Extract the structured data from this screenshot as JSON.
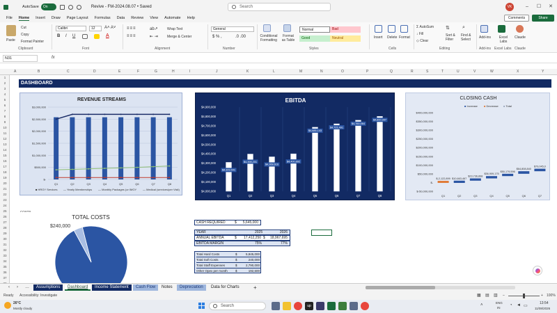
{
  "app": {
    "autosave_label": "AutoSave",
    "autosave_state": "On",
    "doc_title": "Revive - FM-2024.08.07 • Saved",
    "search_placeholder": "Search",
    "user_initials": "VK",
    "comments_label": "Comments",
    "share_label": "Share"
  },
  "menu": [
    "File",
    "Home",
    "Insert",
    "Draw",
    "Page Layout",
    "Formulas",
    "Data",
    "Review",
    "View",
    "Automate",
    "Help"
  ],
  "ribbon": {
    "paste": "Paste",
    "cut": "Cut",
    "copy": "Copy",
    "format_painter": "Format Painter",
    "font_name": "Calibri",
    "font_size": "12",
    "wrap_text": "Wrap Text",
    "merge_center": "Merge & Center",
    "number_format": "General",
    "conditional": "Conditional Formatting",
    "format_table": "Format as Table",
    "style_normal": "Normal",
    "style_bad": "Bad",
    "style_good": "Good",
    "style_neutral": "Neutral",
    "insert": "Insert",
    "delete": "Delete",
    "format": "Format",
    "autosum": "AutoSum",
    "fill": "Fill",
    "clear": "Clear",
    "sort_filter": "Sort & Filter",
    "find_select": "Find & Select",
    "addins": "Add-ins",
    "excel_labs": "Excel Labs",
    "claude": "Claude",
    "groups": [
      "Clipboard",
      "Font",
      "Alignment",
      "Number",
      "Styles",
      "Cells",
      "Editing",
      "Add-ins",
      "Excel Labs",
      "Claude"
    ]
  },
  "formula_bar": {
    "name_box": "N31",
    "fx": "fx",
    "value": ""
  },
  "columns": [
    "A",
    "B",
    "C",
    "D",
    "E",
    "F",
    "G",
    "H",
    "I",
    "J",
    "K",
    "L",
    "M",
    "N",
    "O",
    "P",
    "Q",
    "R",
    "S",
    "T",
    "U",
    "V",
    "W",
    "X",
    "Y"
  ],
  "rows": [
    "1",
    "2",
    "3",
    "4",
    "5",
    "6",
    "7",
    "8",
    "9",
    "10",
    "11",
    "12",
    "13",
    "14",
    "15",
    "16",
    "17",
    "18",
    "19",
    "20",
    "21",
    "22",
    "23",
    "24",
    "25",
    "26",
    "27",
    "28",
    "29",
    "30",
    "31",
    "32",
    "33",
    "34",
    "35",
    "36",
    "37",
    "38",
    "39"
  ],
  "dashboard_title": "DASHBOARD",
  "charts": {
    "revenue": {
      "title": "REVENUE STREAMS",
      "yticks": [
        "$3,000,000",
        "$2,500,000",
        "$2,000,000",
        "$1,500,000",
        "$1,000,000",
        "$500,000",
        "$-"
      ],
      "legend": [
        "HRGY Services",
        "Yearly Memberships",
        "Monthly Packages (or IMGY",
        "Medical (services/per Visit)"
      ]
    },
    "ebitda": {
      "title": "EBITDA",
      "yticks": [
        "$4,900,000",
        "$4,800,000",
        "$4,700,000",
        "$4,600,000",
        "$4,500,000",
        "$4,400,000",
        "$4,300,000",
        "$4,200,000",
        "$4,100,000",
        "$4,000,000"
      ]
    },
    "closing_cash": {
      "title": "CLOSING CASH",
      "legend": [
        "Increase",
        "Decrease",
        "Total"
      ],
      "yticks": [
        "$400,000,000",
        "$350,000,000",
        "$300,000,000",
        "$250,000,000",
        "$200,000,000",
        "$150,000,000",
        "$100,000,000",
        "$50,000,000",
        "$-",
        "$-50,000,000"
      ]
    },
    "total_costs": {
      "section_label": "COSTS",
      "title": "TOTAL COSTS",
      "slice_label": "$240,000"
    }
  },
  "chart_data": [
    {
      "type": "bar",
      "title": "REVENUE STREAMS",
      "categories": [
        "Q1",
        "Q2",
        "Q3",
        "Q4",
        "Q5",
        "Q6",
        "Q7",
        "Q8"
      ],
      "ylim": [
        0,
        3000000
      ],
      "series": [
        {
          "name": "HRGY Services",
          "values": [
            2580000,
            2580000,
            2580000,
            2580000,
            2580000,
            2580000,
            2580000,
            2580000
          ]
        },
        {
          "name": "Yearly Memberships",
          "values": [
            2500000,
            2700000,
            2700000,
            2700000,
            2700000,
            2700000,
            2700000,
            2700000
          ]
        },
        {
          "name": "Monthly Packages (or IMGY",
          "values": [
            400000,
            420000,
            440000,
            460000,
            480000,
            500000,
            530000,
            560000
          ]
        },
        {
          "name": "Medical (services/per Visit)",
          "values": [
            80000,
            80000,
            80000,
            80000,
            80000,
            80000,
            80000,
            80000
          ]
        }
      ]
    },
    {
      "type": "bar",
      "title": "EBITDA",
      "categories": [
        "Q1",
        "Q2",
        "Q3",
        "Q4",
        "Q5",
        "Q6",
        "Q7",
        "Q8"
      ],
      "ylim": [
        4000000,
        4900000
      ],
      "values": [
        4309541,
        4398201,
        4368616,
        4400892,
        4685143,
        4721491,
        4760064,
        4800997
      ],
      "labels": [
        "$4,309,541",
        "$4,398,201",
        "$4,368,616",
        "$4,400,892",
        "$4,685,143",
        "$4,721,491",
        "$4,760,064",
        "$4,800,997"
      ]
    },
    {
      "type": "bar",
      "title": "CLOSING CASH",
      "categories": [
        "Q1",
        "Q2",
        "Q3",
        "Q4",
        "Q5",
        "Q6",
        "Q7"
      ],
      "ylim": [
        -50000000,
        400000000
      ],
      "values": [
        -2122899,
        10663467,
        23736898,
        36909175,
        50179596,
        64808840,
        79045000
      ],
      "labels": [
        "$-2,122,899",
        "$10,663,467",
        "$23,736,898",
        "$36,909,175",
        "$50,179,596",
        "$64,808,840",
        "$79,045,0"
      ]
    },
    {
      "type": "pie",
      "title": "TOTAL COSTS",
      "categories": [
        "Total Hard Costs",
        "Total Soft Costs"
      ],
      "values": [
        5845000,
        240000
      ]
    }
  ],
  "table1": {
    "cash_required_label": "CASH REQUIRED",
    "cash_required_cur": "$",
    "cash_required_value": "5,645,000",
    "year_label": "YEAR",
    "year_1": "2025",
    "year_2": "2026",
    "annual_ebitda_label": "ANNUAL EBITDA",
    "annual_ebitda_cur": "$",
    "annual_ebitda_1": "17,412,250",
    "annual_ebitda_cur2": "$",
    "annual_ebitda_2": "18,967,695",
    "ebitda_margin_label": "EBITDA MARGIN",
    "ebitda_margin_1": "75%",
    "ebitda_margin_2": "77%"
  },
  "table2": {
    "rows": [
      {
        "label": "Total Hard Costs",
        "cur": "$",
        "value": "5,845,000"
      },
      {
        "label": "Total Soft Costs",
        "cur": "$",
        "value": "240,000"
      },
      {
        "label": "Total Staff Expenses",
        "cur": "$",
        "value": "2,790,000"
      },
      {
        "label": "Other Opex per month",
        "cur": "$",
        "value": "192,600"
      }
    ]
  },
  "sheet_tabs": [
    "Assumptions",
    "Dashboard",
    "Income Statement",
    "Cash Flow",
    "Notes",
    "Depreciation",
    "Data for Charts"
  ],
  "status": {
    "ready": "Ready",
    "accessibility": "Accessibility: Investigate",
    "zoom": "100%"
  },
  "taskbar": {
    "weather_temp": "26°C",
    "weather_desc": "Mostly cloudy",
    "search": "Search",
    "lang": "ENG",
    "region": "IN",
    "time": "13:54",
    "date": "11/08/2026"
  },
  "colors": {
    "navy": "#122a63",
    "bar_blue": "#2b55a3",
    "excel_green": "#1a6b3c"
  }
}
